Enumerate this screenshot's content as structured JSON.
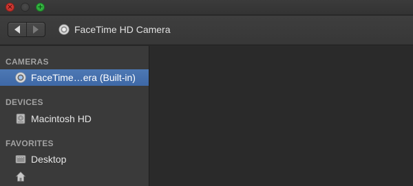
{
  "window": {
    "title": "FaceTime HD Camera",
    "controls": [
      "close",
      "minimize",
      "zoom"
    ]
  },
  "toolbar": {
    "back_icon": "back-arrow-icon",
    "forward_icon": "forward-arrow-icon",
    "path_icon": "camera-icon",
    "path_title": "FaceTime HD Camera"
  },
  "sidebar": {
    "sections": [
      {
        "header": "CAMERAS",
        "items": [
          {
            "label": "FaceTime…era (Built-in)",
            "icon": "camera-icon",
            "selected": true
          }
        ]
      },
      {
        "header": "DEVICES",
        "items": [
          {
            "label": "Macintosh HD",
            "icon": "hard-drive-icon",
            "selected": false
          }
        ]
      },
      {
        "header": "FAVORITES",
        "items": [
          {
            "label": "Desktop",
            "icon": "desktop-icon",
            "selected": false
          },
          {
            "label": "",
            "icon": "home-icon",
            "selected": false
          }
        ]
      }
    ]
  },
  "colors": {
    "selection": "#4470b0",
    "sidebar_bg": "#3a3a3a",
    "content_bg": "#2a2a2a"
  }
}
